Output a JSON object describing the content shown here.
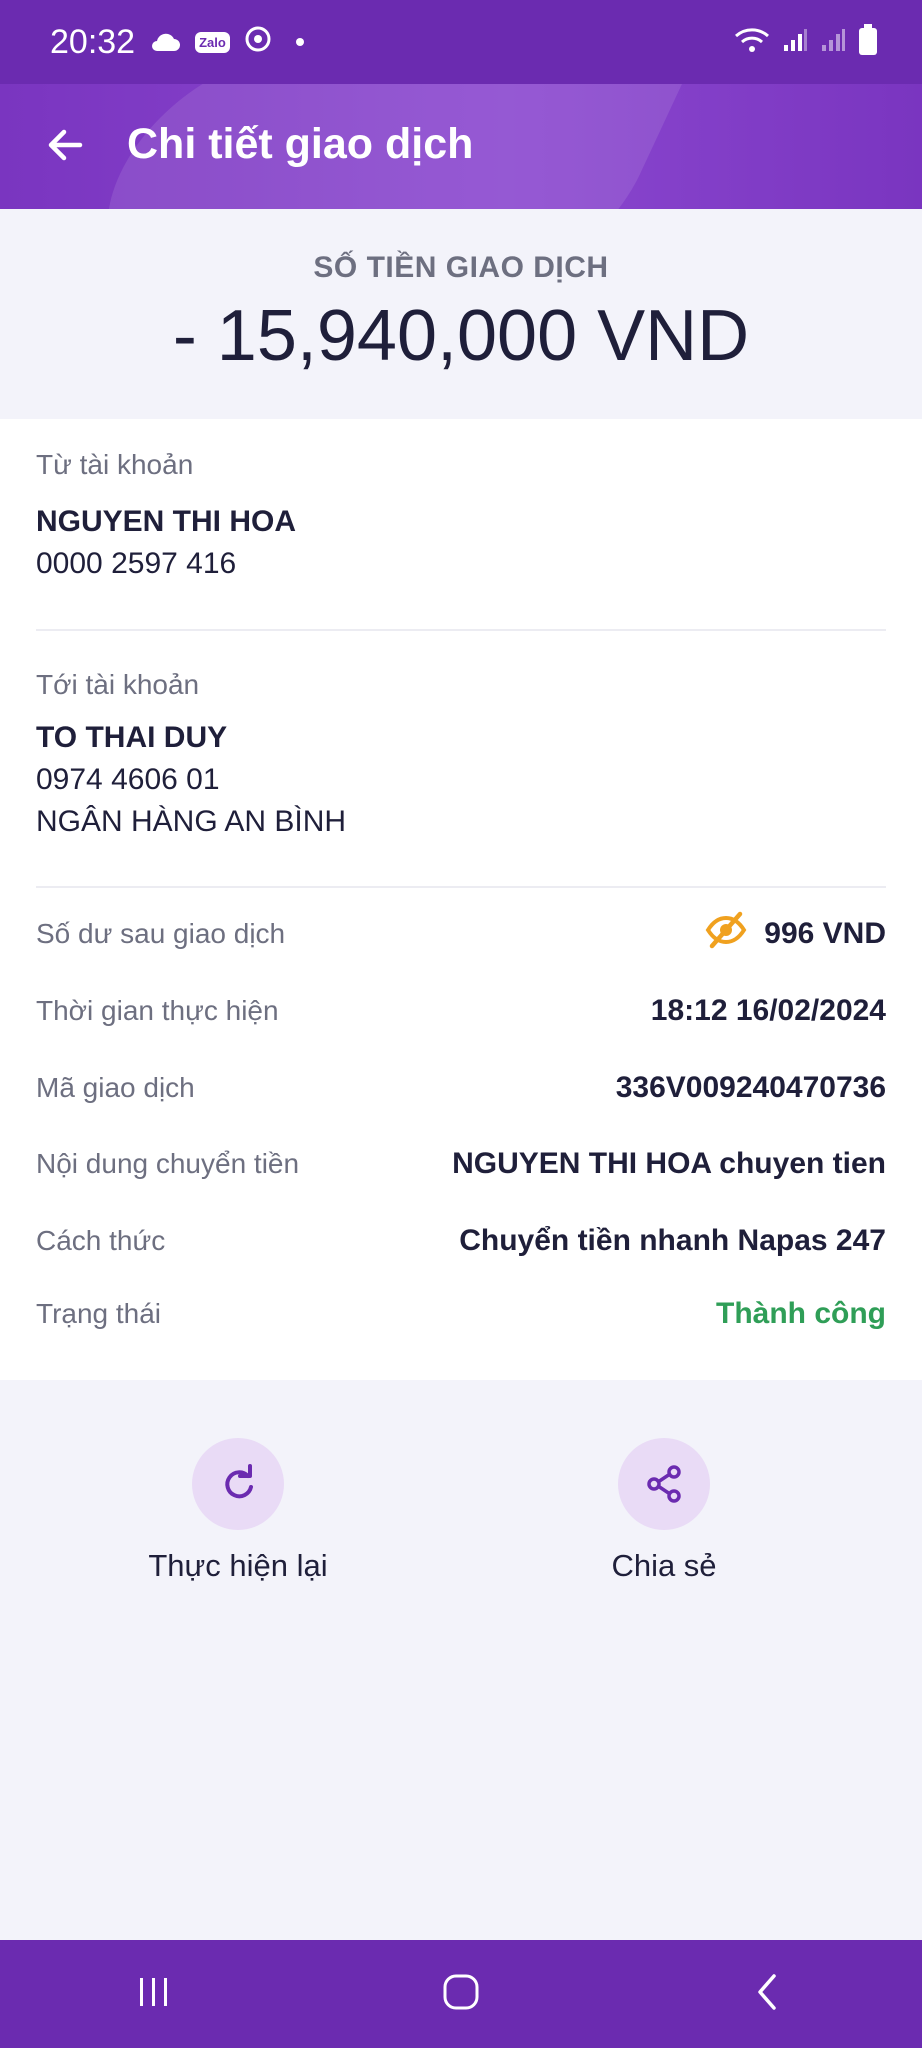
{
  "status_bar": {
    "time": "20:32",
    "icons": [
      "cloud-icon",
      "zalo-icon",
      "sync-icon",
      "notification-dot-icon",
      "wifi-icon",
      "signal-icon",
      "signal-icon-2",
      "battery-icon"
    ],
    "zalo_text": "Zalo"
  },
  "header": {
    "title": "Chi tiết giao dịch",
    "back_icon": "arrow-left-icon"
  },
  "amount": {
    "label": "SỐ TIỀN GIAO DỊCH",
    "value": "- 15,940,000 VND"
  },
  "from_account": {
    "label": "Từ tài khoản",
    "name": "NGUYEN THI HOA",
    "number": "0000 2597 416"
  },
  "to_account": {
    "label": "Tới tài khoản",
    "name": "TO THAI DUY",
    "number": "0974 4606 01",
    "bank": "NGÂN HÀNG AN BÌNH"
  },
  "details": {
    "balance_label": "Số dư sau giao dịch",
    "balance_value": "996 VND",
    "time_label": "Thời gian thực hiện",
    "time_value": "18:12 16/02/2024",
    "code_label": "Mã giao dịch",
    "code_value": "336V009240470736",
    "content_label": "Nội dung chuyển tiền",
    "content_value": "NGUYEN THI HOA chuyen tien",
    "method_label": "Cách thức",
    "method_value": "Chuyển tiền nhanh Napas 247",
    "status_label": "Trạng thái",
    "status_value": "Thành công",
    "status_color": "#2f9e57",
    "eye_icon_color": "#f0a11f"
  },
  "actions": {
    "redo_label": "Thực hiện lại",
    "share_label": "Chia sẻ"
  },
  "nav_bar": {
    "icons": [
      "recent-apps-icon",
      "home-icon",
      "back-icon"
    ]
  },
  "colors": {
    "primary": "#6b2bb0",
    "accent": "#8a47cf"
  }
}
